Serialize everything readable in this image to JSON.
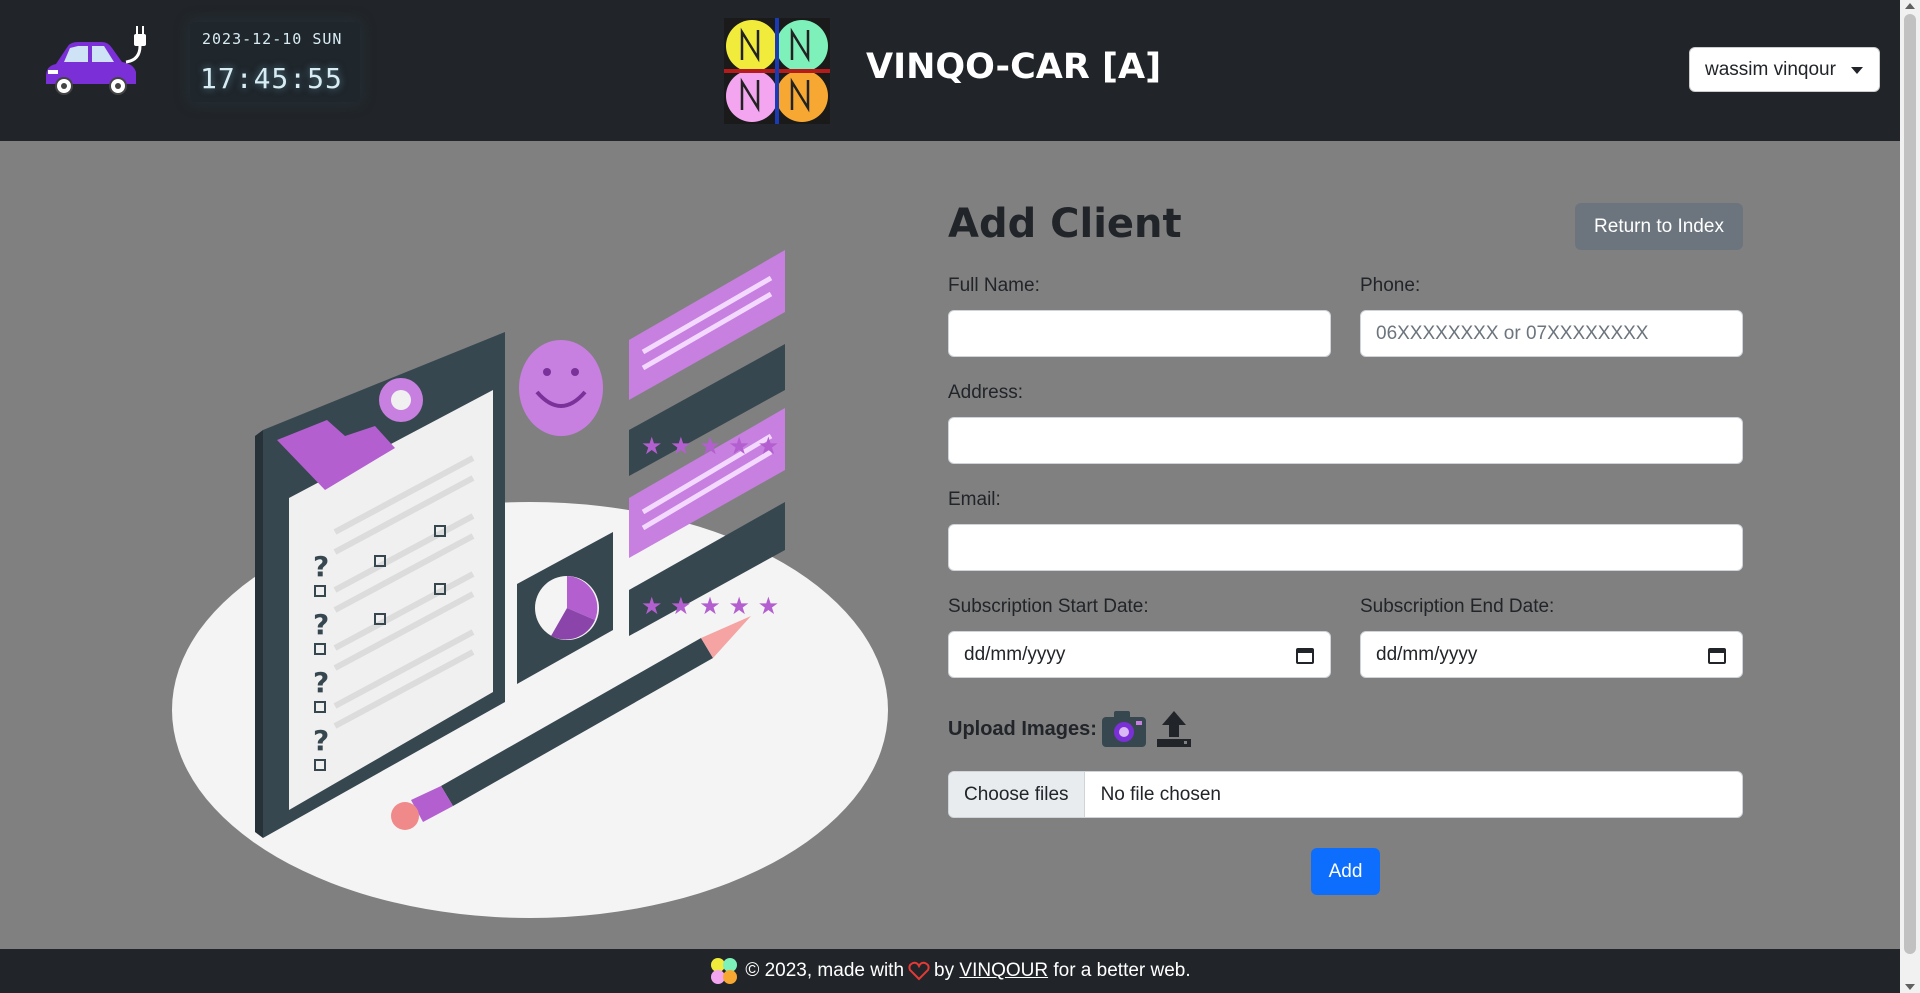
{
  "header": {
    "clock_date": "2023-12-10 SUN",
    "clock_time": "17:45:55",
    "brand_title": "VINQO-CAR [A]",
    "user_name": "wassim vinqour"
  },
  "form": {
    "title": "Add Client",
    "return_label": "Return to Index",
    "full_name_label": "Full Name:",
    "full_name_value": "",
    "phone_label": "Phone:",
    "phone_placeholder": "06XXXXXXXX or 07XXXXXXXX",
    "address_label": "Address:",
    "address_value": "",
    "email_label": "Email:",
    "email_value": "",
    "start_date_label": "Subscription Start Date:",
    "start_date_value": "dd/mm/yyyy",
    "end_date_label": "Subscription End Date:",
    "end_date_value": "dd/mm/yyyy",
    "upload_label": "Upload Images:",
    "choose_files_label": "Choose files",
    "file_status": "No file chosen",
    "add_label": "Add"
  },
  "footer": {
    "copyright": "© 2023, made with",
    "by": "by",
    "author_link": "VINQOUR",
    "tagline": "for a better web."
  },
  "icons": {
    "car_logo": "electric-car-icon",
    "brand_logo": "vinqo-logo",
    "camera": "camera-icon",
    "upload": "upload-icon",
    "calendar": "calendar-icon",
    "heart": "heart-icon"
  },
  "colors": {
    "navbar": "#212529",
    "page_bg": "#808080",
    "primary": "#0d6efd",
    "secondary": "#6c757d",
    "accent_purple": "#b35fd0"
  }
}
